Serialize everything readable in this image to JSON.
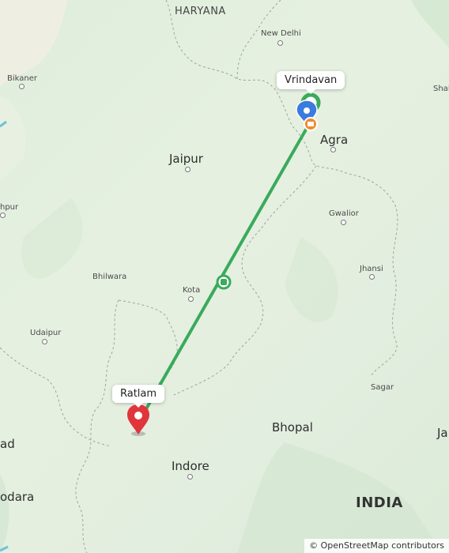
{
  "map": {
    "labels": {
      "haryana": "HARYANA",
      "new_delhi": "New Delhi",
      "bikaner": "Bikaner",
      "jaipur": "Jaipur",
      "agra": "Agra",
      "gwalior": "Gwalior",
      "jodhpur_partial": "hpur",
      "bhilwara": "Bhilwara",
      "kota": "Kota",
      "jhansi": "Jhansi",
      "udaipur": "Udaipur",
      "sagar": "Sagar",
      "bhopal": "Bhopal",
      "indore": "Indore",
      "india": "INDIA",
      "vadodara_partial": "odara",
      "ahmedabad_partial": "ad",
      "jabalpur_partial": "Ja",
      "shahjahanpur_partial": "Shal"
    },
    "route": {
      "origin_label": "Vrindavan",
      "destination_label": "Ratlam",
      "route_color": "#3aaa5c",
      "destination_pin_color": "#e0363b",
      "current_location_color": "#3b7be0",
      "origin_marker_color": "#3aaa5c",
      "poi_marker_color": "#f08a2c"
    },
    "attribution": {
      "symbol": "©",
      "text": "OpenStreetMap contributors"
    }
  }
}
